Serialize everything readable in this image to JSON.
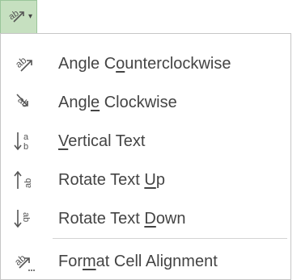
{
  "button": {
    "icon": "orientation-icon",
    "dropdown_icon": "chevron-down-icon",
    "bg_color": "#c6e0c0"
  },
  "menu": {
    "items": [
      {
        "pre": "Angle C",
        "key": "o",
        "post": "unterclockwise",
        "icon": "angle-counterclockwise-icon"
      },
      {
        "pre": "Angl",
        "key": "e",
        "post": " Clockwise",
        "icon": "angle-clockwise-icon"
      },
      {
        "pre": "",
        "key": "V",
        "post": "ertical Text",
        "icon": "vertical-text-icon"
      },
      {
        "pre": "Rotate Text ",
        "key": "U",
        "post": "p",
        "icon": "rotate-text-up-icon"
      },
      {
        "pre": "Rotate Text ",
        "key": "D",
        "post": "own",
        "icon": "rotate-text-down-icon"
      },
      {
        "pre": "For",
        "key": "m",
        "post": "at Cell Alignment",
        "icon": "format-cell-alignment-icon"
      }
    ]
  }
}
